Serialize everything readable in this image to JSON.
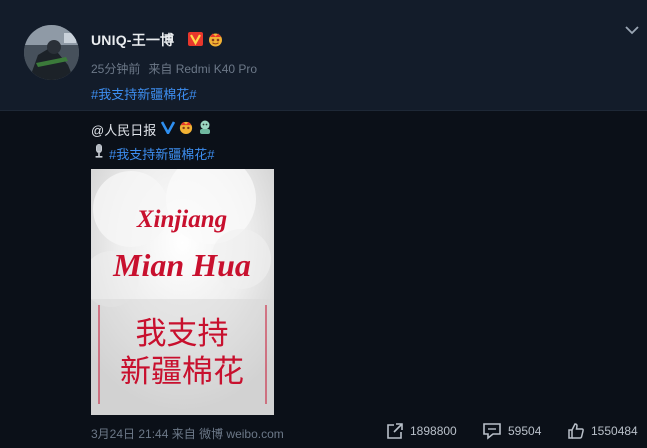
{
  "post": {
    "username": "UNIQ-王一博",
    "time": "25分钟前",
    "source_prefix": "来自",
    "source": "Redmi K40 Pro",
    "hashtag": "#我支持新疆棉花#"
  },
  "repost": {
    "username": "@人民日报",
    "hashtag": "#我支持新疆棉花#",
    "poster": {
      "line1": "Xinjiang",
      "line2": "Mian Hua",
      "line3": "我支持",
      "line4": "新疆棉花"
    },
    "date": "3月24日 21:44",
    "source_prefix": "来自",
    "source": "微博 weibo.com",
    "reposts": "1898800",
    "comments": "59504",
    "likes": "1550484"
  },
  "icons": {
    "verified": "verified-v-icon",
    "crown": "crown-badge-icon",
    "chevron": "chevron-down-icon",
    "mic": "microphone-icon",
    "repost": "repost-icon",
    "comment": "comment-icon",
    "like": "thumbs-up-icon"
  },
  "colors": {
    "background": "#0b1018",
    "card": "#131c2a",
    "link": "#3d8ef0",
    "poster_text": "#c8102e"
  }
}
